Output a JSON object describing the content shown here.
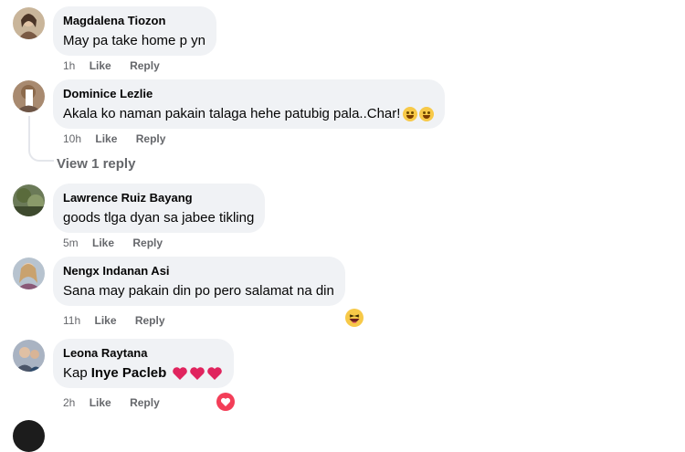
{
  "comments": [
    {
      "author": "Magdalena Tiozon",
      "text": "May pa take home p yn",
      "time": "1h",
      "like": "Like",
      "reply": "Reply"
    },
    {
      "author": "Dominice Lezlie",
      "text": "Akala ko naman pakain talaga hehe patubig pala..Char!",
      "time": "10h",
      "like": "Like",
      "reply": "Reply",
      "emojis": [
        "grin-emoji",
        "grin-emoji"
      ]
    },
    {
      "author": "Lawrence Ruiz Bayang",
      "text": "goods tlga dyan sa jabee tikling",
      "time": "5m",
      "like": "Like",
      "reply": "Reply"
    },
    {
      "author": "Nengx Indanan Asi",
      "text": "Sana may pakain din po pero salamat na din",
      "time": "11h",
      "like": "Like",
      "reply": "Reply",
      "reaction": "haha-reaction"
    },
    {
      "author": "Leona Raytana",
      "text": "Kap",
      "mention": "Inye Pacleb",
      "time": "2h",
      "like": "Like",
      "reply": "Reply",
      "emojis": [
        "heart",
        "heart",
        "heart"
      ],
      "reaction": "love-reaction"
    }
  ],
  "view_reply_label": "View 1 reply",
  "colors": {
    "bubble": "#f0f2f5",
    "muted": "#65676b",
    "heart": "#e0245e",
    "love": "#f33e58",
    "haha": "#f7c948"
  }
}
